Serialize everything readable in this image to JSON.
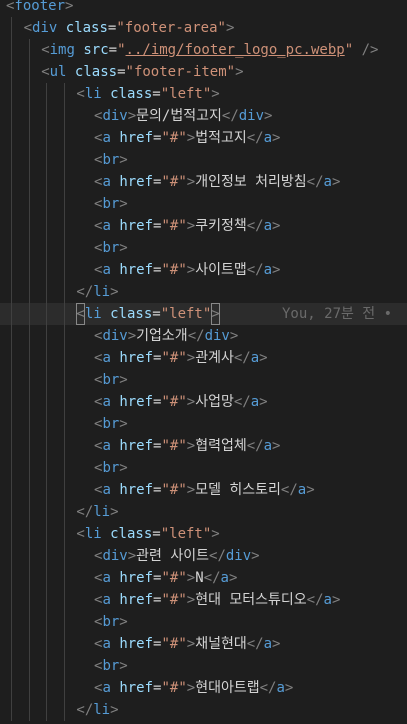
{
  "editor": {
    "lines": [
      {
        "indent": 0,
        "active": false,
        "code": [
          [
            "p",
            "<"
          ],
          [
            "t",
            "footer"
          ],
          [
            "p",
            ">"
          ]
        ]
      },
      {
        "indent": 1,
        "active": false,
        "code": [
          [
            "p",
            "<"
          ],
          [
            "t",
            "div"
          ],
          [
            "x",
            " "
          ],
          [
            "a",
            "class"
          ],
          [
            "x",
            "="
          ],
          [
            "s",
            "\"footer-area\""
          ],
          [
            "p",
            ">"
          ]
        ]
      },
      {
        "indent": 2,
        "active": false,
        "code": [
          [
            "p",
            "<"
          ],
          [
            "t",
            "img"
          ],
          [
            "x",
            " "
          ],
          [
            "a",
            "src"
          ],
          [
            "x",
            "="
          ],
          [
            "s",
            "\""
          ],
          [
            "su",
            "../img/footer_logo_pc.webp"
          ],
          [
            "s",
            "\""
          ],
          [
            "x",
            " "
          ],
          [
            "p",
            "/>"
          ]
        ]
      },
      {
        "indent": 2,
        "active": false,
        "code": [
          [
            "p",
            "<"
          ],
          [
            "t",
            "ul"
          ],
          [
            "x",
            " "
          ],
          [
            "a",
            "class"
          ],
          [
            "x",
            "="
          ],
          [
            "s",
            "\"footer-item\""
          ],
          [
            "p",
            ">"
          ]
        ]
      },
      {
        "indent": 4,
        "active": false,
        "code": [
          [
            "p",
            "<"
          ],
          [
            "t",
            "li"
          ],
          [
            "x",
            " "
          ],
          [
            "a",
            "class"
          ],
          [
            "x",
            "="
          ],
          [
            "s",
            "\"left\""
          ],
          [
            "p",
            ">"
          ]
        ]
      },
      {
        "indent": 5,
        "active": false,
        "code": [
          [
            "p",
            "<"
          ],
          [
            "t",
            "div"
          ],
          [
            "p",
            ">"
          ],
          [
            "x",
            "문의/법적고지"
          ],
          [
            "p",
            "</"
          ],
          [
            "t",
            "div"
          ],
          [
            "p",
            ">"
          ]
        ]
      },
      {
        "indent": 5,
        "active": false,
        "code": [
          [
            "p",
            "<"
          ],
          [
            "t",
            "a"
          ],
          [
            "x",
            " "
          ],
          [
            "a",
            "href"
          ],
          [
            "x",
            "="
          ],
          [
            "s",
            "\"#\""
          ],
          [
            "p",
            ">"
          ],
          [
            "x",
            "법적고지"
          ],
          [
            "p",
            "</"
          ],
          [
            "t",
            "a"
          ],
          [
            "p",
            ">"
          ]
        ]
      },
      {
        "indent": 5,
        "active": false,
        "code": [
          [
            "p",
            "<"
          ],
          [
            "t",
            "br"
          ],
          [
            "p",
            ">"
          ]
        ]
      },
      {
        "indent": 5,
        "active": false,
        "code": [
          [
            "p",
            "<"
          ],
          [
            "t",
            "a"
          ],
          [
            "x",
            " "
          ],
          [
            "a",
            "href"
          ],
          [
            "x",
            "="
          ],
          [
            "s",
            "\"#\""
          ],
          [
            "p",
            ">"
          ],
          [
            "x",
            "개인정보 처리방침"
          ],
          [
            "p",
            "</"
          ],
          [
            "t",
            "a"
          ],
          [
            "p",
            ">"
          ]
        ]
      },
      {
        "indent": 5,
        "active": false,
        "code": [
          [
            "p",
            "<"
          ],
          [
            "t",
            "br"
          ],
          [
            "p",
            ">"
          ]
        ]
      },
      {
        "indent": 5,
        "active": false,
        "code": [
          [
            "p",
            "<"
          ],
          [
            "t",
            "a"
          ],
          [
            "x",
            " "
          ],
          [
            "a",
            "href"
          ],
          [
            "x",
            "="
          ],
          [
            "s",
            "\"#\""
          ],
          [
            "p",
            ">"
          ],
          [
            "x",
            "쿠키정책"
          ],
          [
            "p",
            "</"
          ],
          [
            "t",
            "a"
          ],
          [
            "p",
            ">"
          ]
        ]
      },
      {
        "indent": 5,
        "active": false,
        "code": [
          [
            "p",
            "<"
          ],
          [
            "t",
            "br"
          ],
          [
            "p",
            ">"
          ]
        ]
      },
      {
        "indent": 5,
        "active": false,
        "code": [
          [
            "p",
            "<"
          ],
          [
            "t",
            "a"
          ],
          [
            "x",
            " "
          ],
          [
            "a",
            "href"
          ],
          [
            "x",
            "="
          ],
          [
            "s",
            "\"#\""
          ],
          [
            "p",
            ">"
          ],
          [
            "x",
            "사이트맵"
          ],
          [
            "p",
            "</"
          ],
          [
            "t",
            "a"
          ],
          [
            "p",
            ">"
          ]
        ]
      },
      {
        "indent": 4,
        "active": false,
        "code": [
          [
            "p",
            "</"
          ],
          [
            "t",
            "li"
          ],
          [
            "p",
            ">"
          ]
        ]
      },
      {
        "indent": 4,
        "active": true,
        "blame": "You, 27분 전 •",
        "code": [
          [
            "bp",
            "<"
          ],
          [
            "t",
            "li"
          ],
          [
            "x",
            " "
          ],
          [
            "a",
            "class"
          ],
          [
            "x",
            "="
          ],
          [
            "s",
            "\"left\""
          ],
          [
            "bp",
            ">"
          ]
        ]
      },
      {
        "indent": 5,
        "active": false,
        "code": [
          [
            "p",
            "<"
          ],
          [
            "t",
            "div"
          ],
          [
            "p",
            ">"
          ],
          [
            "x",
            "기업소개"
          ],
          [
            "p",
            "</"
          ],
          [
            "t",
            "div"
          ],
          [
            "p",
            ">"
          ]
        ]
      },
      {
        "indent": 5,
        "active": false,
        "code": [
          [
            "p",
            "<"
          ],
          [
            "t",
            "a"
          ],
          [
            "x",
            " "
          ],
          [
            "a",
            "href"
          ],
          [
            "x",
            "="
          ],
          [
            "s",
            "\"#\""
          ],
          [
            "p",
            ">"
          ],
          [
            "x",
            "관계사"
          ],
          [
            "p",
            "</"
          ],
          [
            "t",
            "a"
          ],
          [
            "p",
            ">"
          ]
        ]
      },
      {
        "indent": 5,
        "active": false,
        "code": [
          [
            "p",
            "<"
          ],
          [
            "t",
            "br"
          ],
          [
            "p",
            ">"
          ]
        ]
      },
      {
        "indent": 5,
        "active": false,
        "code": [
          [
            "p",
            "<"
          ],
          [
            "t",
            "a"
          ],
          [
            "x",
            " "
          ],
          [
            "a",
            "href"
          ],
          [
            "x",
            "="
          ],
          [
            "s",
            "\"#\""
          ],
          [
            "p",
            ">"
          ],
          [
            "x",
            "사업망"
          ],
          [
            "p",
            "</"
          ],
          [
            "t",
            "a"
          ],
          [
            "p",
            ">"
          ]
        ]
      },
      {
        "indent": 5,
        "active": false,
        "code": [
          [
            "p",
            "<"
          ],
          [
            "t",
            "br"
          ],
          [
            "p",
            ">"
          ]
        ]
      },
      {
        "indent": 5,
        "active": false,
        "code": [
          [
            "p",
            "<"
          ],
          [
            "t",
            "a"
          ],
          [
            "x",
            " "
          ],
          [
            "a",
            "href"
          ],
          [
            "x",
            "="
          ],
          [
            "s",
            "\"#\""
          ],
          [
            "p",
            ">"
          ],
          [
            "x",
            "협력업체"
          ],
          [
            "p",
            "</"
          ],
          [
            "t",
            "a"
          ],
          [
            "p",
            ">"
          ]
        ]
      },
      {
        "indent": 5,
        "active": false,
        "code": [
          [
            "p",
            "<"
          ],
          [
            "t",
            "br"
          ],
          [
            "p",
            ">"
          ]
        ]
      },
      {
        "indent": 5,
        "active": false,
        "code": [
          [
            "p",
            "<"
          ],
          [
            "t",
            "a"
          ],
          [
            "x",
            " "
          ],
          [
            "a",
            "href"
          ],
          [
            "x",
            "="
          ],
          [
            "s",
            "\"#\""
          ],
          [
            "p",
            ">"
          ],
          [
            "x",
            "모델 히스토리"
          ],
          [
            "p",
            "</"
          ],
          [
            "t",
            "a"
          ],
          [
            "p",
            ">"
          ]
        ]
      },
      {
        "indent": 4,
        "active": false,
        "code": [
          [
            "p",
            "</"
          ],
          [
            "t",
            "li"
          ],
          [
            "p",
            ">"
          ]
        ]
      },
      {
        "indent": 4,
        "active": false,
        "code": [
          [
            "p",
            "<"
          ],
          [
            "t",
            "li"
          ],
          [
            "x",
            " "
          ],
          [
            "a",
            "class"
          ],
          [
            "x",
            "="
          ],
          [
            "s",
            "\"left\""
          ],
          [
            "p",
            ">"
          ]
        ]
      },
      {
        "indent": 5,
        "active": false,
        "code": [
          [
            "p",
            "<"
          ],
          [
            "t",
            "div"
          ],
          [
            "p",
            ">"
          ],
          [
            "x",
            "관련 사이트"
          ],
          [
            "p",
            "</"
          ],
          [
            "t",
            "div"
          ],
          [
            "p",
            ">"
          ]
        ]
      },
      {
        "indent": 5,
        "active": false,
        "code": [
          [
            "p",
            "<"
          ],
          [
            "t",
            "a"
          ],
          [
            "x",
            " "
          ],
          [
            "a",
            "href"
          ],
          [
            "x",
            "="
          ],
          [
            "s",
            "\"#\""
          ],
          [
            "p",
            ">"
          ],
          [
            "x",
            "N"
          ],
          [
            "p",
            "</"
          ],
          [
            "t",
            "a"
          ],
          [
            "p",
            ">"
          ]
        ]
      },
      {
        "indent": 5,
        "active": false,
        "code": [
          [
            "p",
            "<"
          ],
          [
            "t",
            "a"
          ],
          [
            "x",
            " "
          ],
          [
            "a",
            "href"
          ],
          [
            "x",
            "="
          ],
          [
            "s",
            "\"#\""
          ],
          [
            "p",
            ">"
          ],
          [
            "x",
            "현대 모터스튜디오"
          ],
          [
            "p",
            "</"
          ],
          [
            "t",
            "a"
          ],
          [
            "p",
            ">"
          ]
        ]
      },
      {
        "indent": 5,
        "active": false,
        "code": [
          [
            "p",
            "<"
          ],
          [
            "t",
            "br"
          ],
          [
            "p",
            ">"
          ]
        ]
      },
      {
        "indent": 5,
        "active": false,
        "code": [
          [
            "p",
            "<"
          ],
          [
            "t",
            "a"
          ],
          [
            "x",
            " "
          ],
          [
            "a",
            "href"
          ],
          [
            "x",
            "="
          ],
          [
            "s",
            "\"#\""
          ],
          [
            "p",
            ">"
          ],
          [
            "x",
            "채널현대"
          ],
          [
            "p",
            "</"
          ],
          [
            "t",
            "a"
          ],
          [
            "p",
            ">"
          ]
        ]
      },
      {
        "indent": 5,
        "active": false,
        "code": [
          [
            "p",
            "<"
          ],
          [
            "t",
            "br"
          ],
          [
            "p",
            ">"
          ]
        ]
      },
      {
        "indent": 5,
        "active": false,
        "code": [
          [
            "p",
            "<"
          ],
          [
            "t",
            "a"
          ],
          [
            "x",
            " "
          ],
          [
            "a",
            "href"
          ],
          [
            "x",
            "="
          ],
          [
            "s",
            "\"#\""
          ],
          [
            "p",
            ">"
          ],
          [
            "x",
            "현대아트랩"
          ],
          [
            "p",
            "</"
          ],
          [
            "t",
            "a"
          ],
          [
            "p",
            ">"
          ]
        ]
      },
      {
        "indent": 4,
        "active": false,
        "code": [
          [
            "p",
            "</"
          ],
          [
            "t",
            "li"
          ],
          [
            "p",
            ">"
          ]
        ]
      }
    ]
  },
  "colors": {
    "background": "#1e1e1e",
    "active_line": "#2c2c2c",
    "punctuation": "#808080",
    "tag": "#569cd6",
    "attribute": "#9cdcfe",
    "string": "#ce9178",
    "text": "#d4d4d4",
    "blame": "#6a6a6a"
  }
}
